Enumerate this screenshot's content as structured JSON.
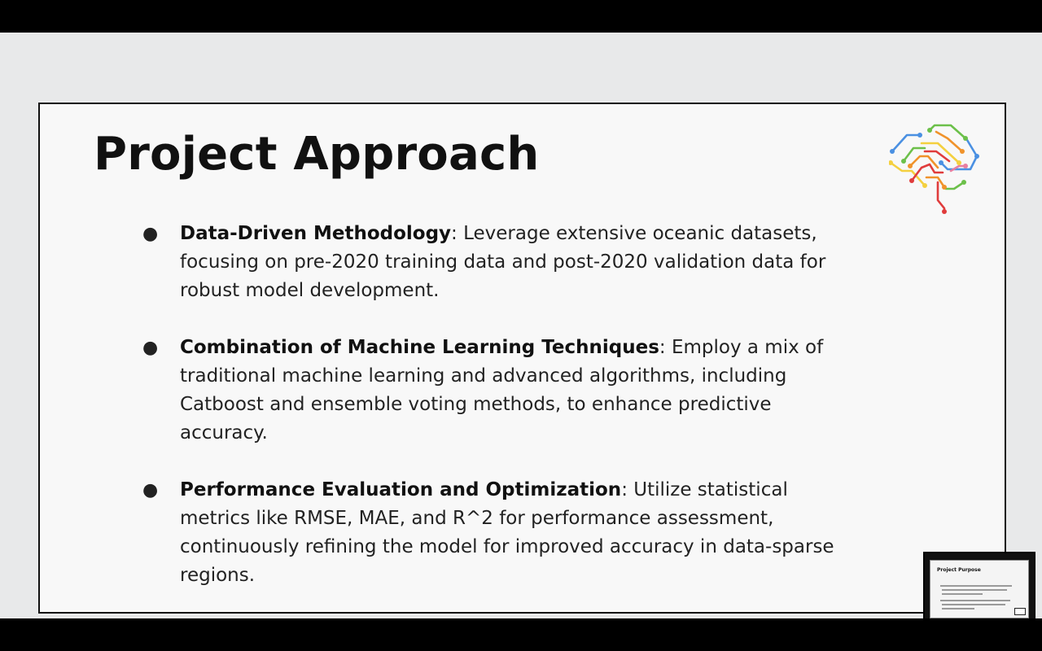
{
  "slide": {
    "title": "Project Approach",
    "bullets": [
      {
        "marker": "●",
        "heading": "Data-Driven Methodology",
        "body": ": Leverage extensive oceanic datasets, focusing on pre-2020 training data and post-2020 validation data for robust model development."
      },
      {
        "marker": "●",
        "heading": "Combination of Machine Learning Techniques",
        "body": ": Employ a mix of traditional machine learning and advanced algorithms, including Catboost and ensemble voting methods, to enhance predictive accuracy."
      },
      {
        "marker": "●",
        "heading": "Performance Evaluation and Optimization",
        "body": ": Utilize statistical metrics like RMSE, MAE, and R^2 for performance assessment, continuously refining the model for improved accuracy in data-sparse regions."
      }
    ],
    "logo_icon": "circuit-brain-icon",
    "colors": {
      "background": "#f8f8f8",
      "border": "#111111",
      "title": "#111111",
      "logo_blue": "#4a90e2",
      "logo_green": "#6cc04a",
      "logo_orange": "#f0932b",
      "logo_red": "#e03c3c",
      "logo_yellow": "#f4d03f",
      "logo_pink": "#e87fa0"
    }
  },
  "thumbnail": {
    "title": "Project Purpose"
  }
}
